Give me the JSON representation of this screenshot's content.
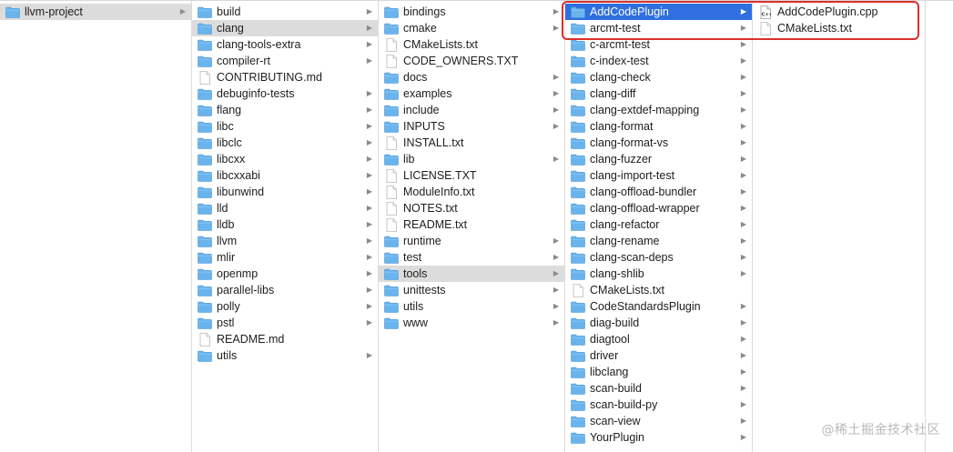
{
  "columns": [
    {
      "items": [
        {
          "label": "llvm-project",
          "type": "folder",
          "selected": "gray",
          "chevron": true
        }
      ]
    },
    {
      "items": [
        {
          "label": "build",
          "type": "folder",
          "chevron": true
        },
        {
          "label": "clang",
          "type": "folder",
          "selected": "gray",
          "chevron": true
        },
        {
          "label": "clang-tools-extra",
          "type": "folder",
          "chevron": true
        },
        {
          "label": "compiler-rt",
          "type": "folder",
          "chevron": true
        },
        {
          "label": "CONTRIBUTING.md",
          "type": "file"
        },
        {
          "label": "debuginfo-tests",
          "type": "folder",
          "chevron": true
        },
        {
          "label": "flang",
          "type": "folder",
          "chevron": true
        },
        {
          "label": "libc",
          "type": "folder",
          "chevron": true
        },
        {
          "label": "libclc",
          "type": "folder",
          "chevron": true
        },
        {
          "label": "libcxx",
          "type": "folder",
          "chevron": true
        },
        {
          "label": "libcxxabi",
          "type": "folder",
          "chevron": true
        },
        {
          "label": "libunwind",
          "type": "folder",
          "chevron": true
        },
        {
          "label": "lld",
          "type": "folder",
          "chevron": true
        },
        {
          "label": "lldb",
          "type": "folder",
          "chevron": true
        },
        {
          "label": "llvm",
          "type": "folder",
          "chevron": true
        },
        {
          "label": "mlir",
          "type": "folder",
          "chevron": true
        },
        {
          "label": "openmp",
          "type": "folder",
          "chevron": true
        },
        {
          "label": "parallel-libs",
          "type": "folder",
          "chevron": true
        },
        {
          "label": "polly",
          "type": "folder",
          "chevron": true
        },
        {
          "label": "pstl",
          "type": "folder",
          "chevron": true
        },
        {
          "label": "README.md",
          "type": "file"
        },
        {
          "label": "utils",
          "type": "folder",
          "chevron": true
        }
      ]
    },
    {
      "items": [
        {
          "label": "bindings",
          "type": "folder",
          "chevron": true
        },
        {
          "label": "cmake",
          "type": "folder",
          "chevron": true
        },
        {
          "label": "CMakeLists.txt",
          "type": "file"
        },
        {
          "label": "CODE_OWNERS.TXT",
          "type": "file"
        },
        {
          "label": "docs",
          "type": "folder",
          "chevron": true
        },
        {
          "label": "examples",
          "type": "folder",
          "chevron": true
        },
        {
          "label": "include",
          "type": "folder",
          "chevron": true
        },
        {
          "label": "INPUTS",
          "type": "folder",
          "chevron": true
        },
        {
          "label": "INSTALL.txt",
          "type": "file"
        },
        {
          "label": "lib",
          "type": "folder",
          "chevron": true
        },
        {
          "label": "LICENSE.TXT",
          "type": "file"
        },
        {
          "label": "ModuleInfo.txt",
          "type": "file"
        },
        {
          "label": "NOTES.txt",
          "type": "file"
        },
        {
          "label": "README.txt",
          "type": "file"
        },
        {
          "label": "runtime",
          "type": "folder",
          "chevron": true
        },
        {
          "label": "test",
          "type": "folder",
          "chevron": true
        },
        {
          "label": "tools",
          "type": "folder",
          "selected": "gray",
          "chevron": true
        },
        {
          "label": "unittests",
          "type": "folder",
          "chevron": true
        },
        {
          "label": "utils",
          "type": "folder",
          "chevron": true
        },
        {
          "label": "www",
          "type": "folder",
          "chevron": true
        }
      ]
    },
    {
      "items": [
        {
          "label": "AddCodePlugin",
          "type": "folder",
          "selected": "blue",
          "chevron": true
        },
        {
          "label": "arcmt-test",
          "type": "folder",
          "chevron": true
        },
        {
          "label": "c-arcmt-test",
          "type": "folder",
          "chevron": true
        },
        {
          "label": "c-index-test",
          "type": "folder",
          "chevron": true
        },
        {
          "label": "clang-check",
          "type": "folder",
          "chevron": true
        },
        {
          "label": "clang-diff",
          "type": "folder",
          "chevron": true
        },
        {
          "label": "clang-extdef-mapping",
          "type": "folder",
          "chevron": true
        },
        {
          "label": "clang-format",
          "type": "folder",
          "chevron": true
        },
        {
          "label": "clang-format-vs",
          "type": "folder",
          "chevron": true
        },
        {
          "label": "clang-fuzzer",
          "type": "folder",
          "chevron": true
        },
        {
          "label": "clang-import-test",
          "type": "folder",
          "chevron": true
        },
        {
          "label": "clang-offload-bundler",
          "type": "folder",
          "chevron": true
        },
        {
          "label": "clang-offload-wrapper",
          "type": "folder",
          "chevron": true
        },
        {
          "label": "clang-refactor",
          "type": "folder",
          "chevron": true
        },
        {
          "label": "clang-rename",
          "type": "folder",
          "chevron": true
        },
        {
          "label": "clang-scan-deps",
          "type": "folder",
          "chevron": true
        },
        {
          "label": "clang-shlib",
          "type": "folder",
          "chevron": true
        },
        {
          "label": "CMakeLists.txt",
          "type": "file"
        },
        {
          "label": "CodeStandardsPlugin",
          "type": "folder",
          "chevron": true
        },
        {
          "label": "diag-build",
          "type": "folder",
          "chevron": true
        },
        {
          "label": "diagtool",
          "type": "folder",
          "chevron": true
        },
        {
          "label": "driver",
          "type": "folder",
          "chevron": true
        },
        {
          "label": "libclang",
          "type": "folder",
          "chevron": true
        },
        {
          "label": "scan-build",
          "type": "folder",
          "chevron": true
        },
        {
          "label": "scan-build-py",
          "type": "folder",
          "chevron": true
        },
        {
          "label": "scan-view",
          "type": "folder",
          "chevron": true
        },
        {
          "label": "YourPlugin",
          "type": "folder",
          "chevron": true
        }
      ]
    },
    {
      "items": [
        {
          "label": "AddCodePlugin.cpp",
          "type": "cpp"
        },
        {
          "label": "CMakeLists.txt",
          "type": "file"
        }
      ]
    },
    {
      "items": []
    }
  ],
  "watermark": "@稀土掘金技术社区",
  "colors": {
    "folder": "#6ab4ee",
    "selection_blue": "#2f6fe0",
    "selection_gray": "#dcdcdc",
    "highlight_box": "#d9302c"
  }
}
